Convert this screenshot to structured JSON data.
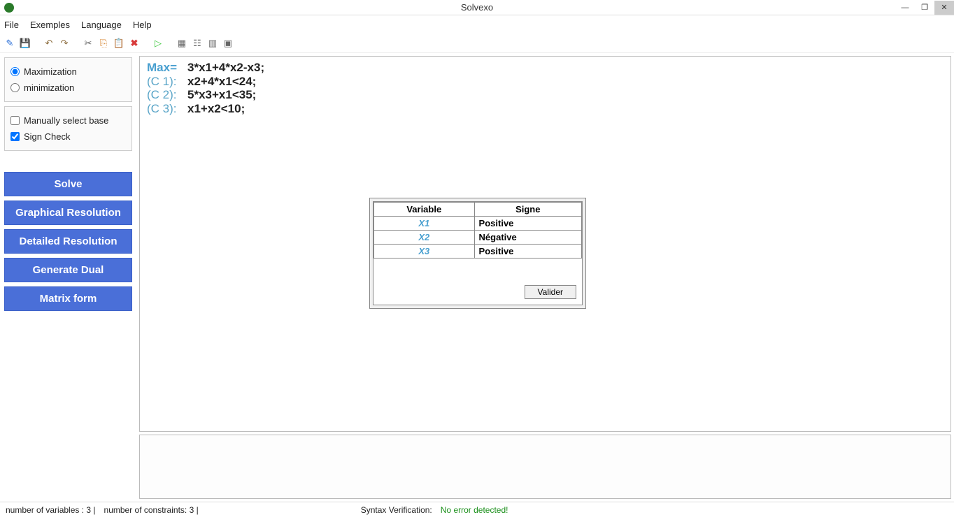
{
  "window": {
    "title": "Solvexo"
  },
  "menu": {
    "file": "File",
    "exemples": "Exemples",
    "language": "Language",
    "help": "Help"
  },
  "sidebar": {
    "opt_max": "Maximization",
    "opt_min": "minimization",
    "chk_manual": "Manually select base",
    "chk_sign": "Sign Check",
    "btn_solve": "Solve",
    "btn_graph": "Graphical Resolution",
    "btn_detail": "Detailed Resolution",
    "btn_dual": "Generate Dual",
    "btn_matrix": "Matrix form"
  },
  "editor": {
    "lines": [
      {
        "label": "Max=",
        "expr": "3*x1+4*x2-x3;",
        "cls": "max"
      },
      {
        "label": "(C 1):",
        "expr": "x2+4*x1<24;",
        "cls": ""
      },
      {
        "label": "(C 2):",
        "expr": "5*x3+x1<35;",
        "cls": ""
      },
      {
        "label": "(C 3):",
        "expr": "x1+x2<10;",
        "cls": ""
      }
    ]
  },
  "dialog": {
    "col_var": "Variable",
    "col_sign": "Signe",
    "rows": [
      {
        "var": "X1",
        "sign": "Positive"
      },
      {
        "var": "X2",
        "sign": "Négative"
      },
      {
        "var": "X3",
        "sign": "Positive"
      }
    ],
    "btn_valider": "Valider"
  },
  "status": {
    "vars": "number of variables : 3  |",
    "cons": "number of constraints: 3  |",
    "syntax_label": "Syntax Verification:",
    "syntax_ok": "No error detected!"
  }
}
